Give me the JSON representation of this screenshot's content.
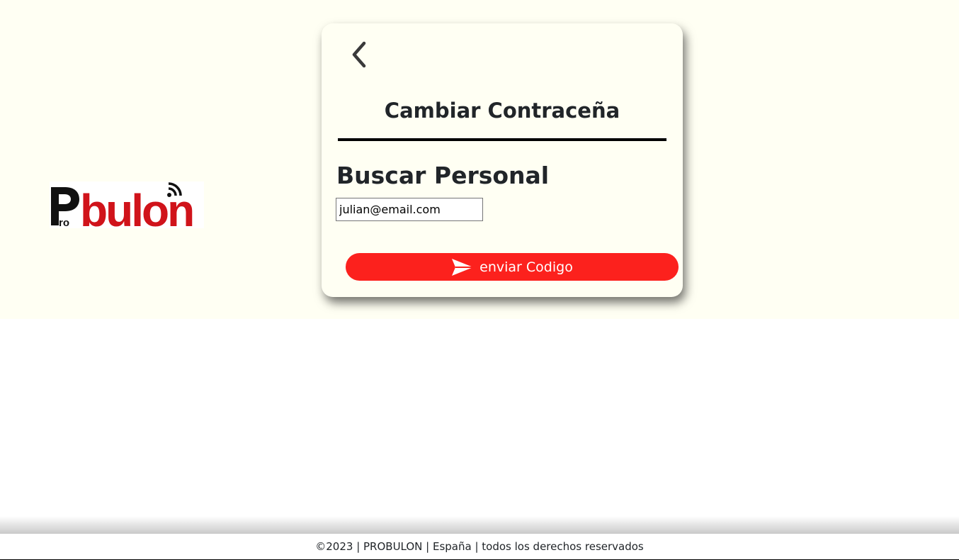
{
  "logo": {
    "text_pro": "Pro",
    "text_bulon": "bulon",
    "brand_red": "#d0131a",
    "brand_black": "#111111"
  },
  "card": {
    "back_icon": "chevron-left-icon",
    "title": "Cambiar Contraceña",
    "section_heading": "Buscar Personal",
    "email_value": "julian@email.com",
    "email_placeholder": "",
    "send_button_label": "enviar Codigo",
    "send_icon": "paper-plane-icon"
  },
  "footer": {
    "text": "©2023 | PROBULON | España | todos los derechos reservados"
  },
  "colors": {
    "hero_background": "#fffff3",
    "accent": "#fc211d",
    "text": "#212529"
  }
}
